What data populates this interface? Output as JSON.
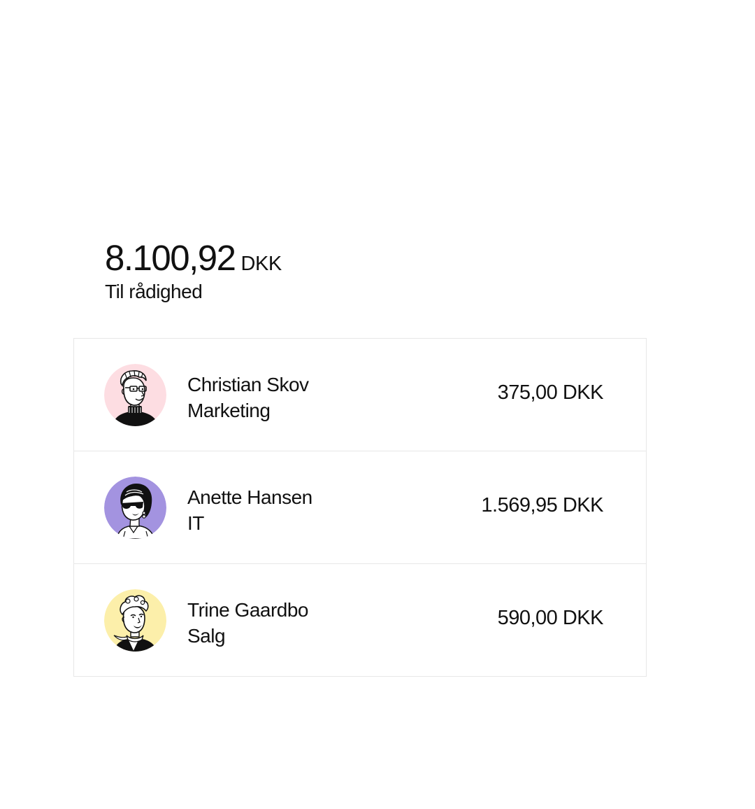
{
  "balance": {
    "amount": "8.100,92",
    "currency": "DKK",
    "label": "Til rådighed"
  },
  "employees": [
    {
      "name": "Christian Skov",
      "department": "Marketing",
      "amount": "375,00 DKK",
      "avatar_color": "#fddde2",
      "avatar_icon": "man-with-glasses-portrait-icon"
    },
    {
      "name": "Anette Hansen",
      "department": "IT",
      "amount": "1.569,95 DKK",
      "avatar_color": "#a393e0",
      "avatar_icon": "woman-with-sunglasses-portrait-icon"
    },
    {
      "name": "Trine Gaardbo",
      "department": "Salg",
      "amount": "590,00 DKK",
      "avatar_color": "#fcefaa",
      "avatar_icon": "woman-with-scarf-portrait-icon"
    }
  ]
}
